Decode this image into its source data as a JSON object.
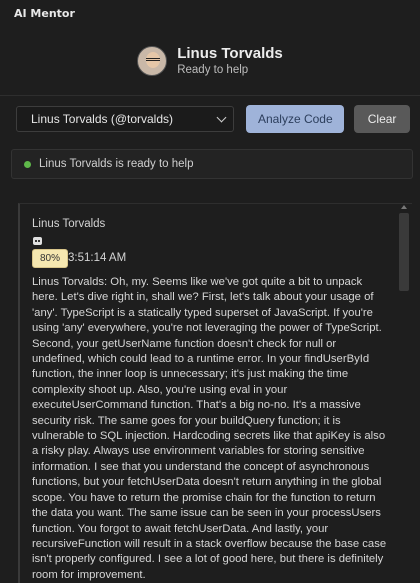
{
  "app": {
    "title": "AI Mentor"
  },
  "header": {
    "name": "Linus Torvalds",
    "status": "Ready to help"
  },
  "controls": {
    "mentor_select": "Linus Torvalds (@torvalds)",
    "analyze_label": "Analyze Code",
    "clear_label": "Clear"
  },
  "status_bar": {
    "text": "Linus Torvalds is ready to help",
    "color": "#5fb84a"
  },
  "message": {
    "author": "Linus Torvalds",
    "icon": "robot-icon",
    "zoom": "80%",
    "time": "3:51:14 AM",
    "text": "Linus Torvalds: Oh, my. Seems like we've got quite a bit to unpack here. Let's dive right in, shall we? First, let's talk about your usage of 'any'. TypeScript is a statically typed superset of JavaScript. If you're using 'any' everywhere, you're not leveraging the power of TypeScript. Second, your getUserName function doesn't check for null or undefined, which could lead to a runtime error. In your findUserById function, the inner loop is unnecessary; it's just making the time complexity shoot up. Also, you're using eval in your executeUserCommand function. That's a big no-no. It's a massive security risk. The same goes for your buildQuery function; it is vulnerable to SQL injection. Hardcoding secrets like that apiKey is also a risky play. Always use environment variables for storing sensitive information. I see that you understand the concept of asynchronous functions, but your fetchUserData doesn't return anything in the global scope. You have to return the promise chain for the function to return the data you want. The same issue can be seen in your processUsers function. You forgot to await fetchUserData. And lastly, your recursiveFunction will result in a stack overflow because the base case isn't properly configured. I see a lot of good here, but there is definitely room for improvement."
  },
  "colors": {
    "accent": "#9fb3d9",
    "background": "#1e1e1e"
  }
}
